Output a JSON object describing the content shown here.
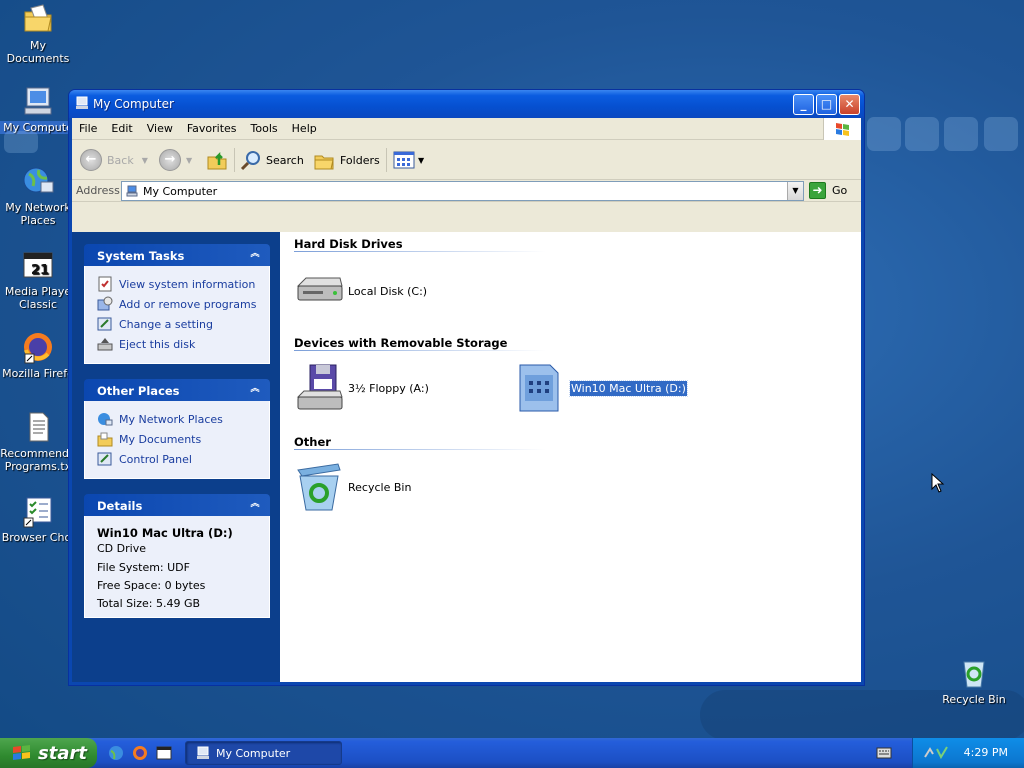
{
  "desktop": {
    "icons": [
      {
        "id": "my-documents",
        "label": "My Documents"
      },
      {
        "id": "my-computer",
        "label": "My Compute"
      },
      {
        "id": "my-network-places",
        "label": "My Network\nPlaces"
      },
      {
        "id": "media-player-classic",
        "label": "Media Playe\nClassic"
      },
      {
        "id": "mozilla-firefox",
        "label": "Mozilla Firefo"
      },
      {
        "id": "recommended-programs",
        "label": "Recommende\nPrograms.tx"
      },
      {
        "id": "browser-choice",
        "label": "Browser Choi"
      },
      {
        "id": "recycle-bin",
        "label": "Recycle Bin"
      }
    ]
  },
  "window": {
    "title": "My Computer",
    "menu": [
      "File",
      "Edit",
      "View",
      "Favorites",
      "Tools",
      "Help"
    ],
    "toolbar": {
      "back": "Back",
      "search": "Search",
      "folders": "Folders"
    },
    "address": {
      "label": "Address",
      "value": "My Computer",
      "go": "Go"
    },
    "panels": {
      "system_tasks": {
        "title": "System Tasks",
        "links": [
          "View system information",
          "Add or remove programs",
          "Change a setting",
          "Eject this disk"
        ]
      },
      "other_places": {
        "title": "Other Places",
        "links": [
          "My Network Places",
          "My Documents",
          "Control Panel"
        ]
      },
      "details": {
        "title": "Details",
        "name": "Win10 Mac Ultra (D:)",
        "type": "CD Drive",
        "file_system": "File System: UDF",
        "free_space": "Free Space: 0 bytes",
        "total_size": "Total Size: 5.49 GB"
      }
    },
    "groups": {
      "hard_disks": {
        "title": "Hard Disk Drives",
        "items": [
          "Local Disk (C:)"
        ]
      },
      "removable": {
        "title": "Devices with Removable Storage",
        "items": [
          "3½ Floppy (A:)",
          "Win10 Mac Ultra (D:)"
        ]
      },
      "other": {
        "title": "Other",
        "items": [
          "Recycle Bin"
        ]
      }
    }
  },
  "taskbar": {
    "start": "start",
    "task": "My Computer",
    "clock": "4:29 PM"
  },
  "colors": {
    "accent": "#0b47b0",
    "selection": "#316ac5",
    "start_green": "#2f8a2f",
    "link": "#1a3d9f"
  }
}
